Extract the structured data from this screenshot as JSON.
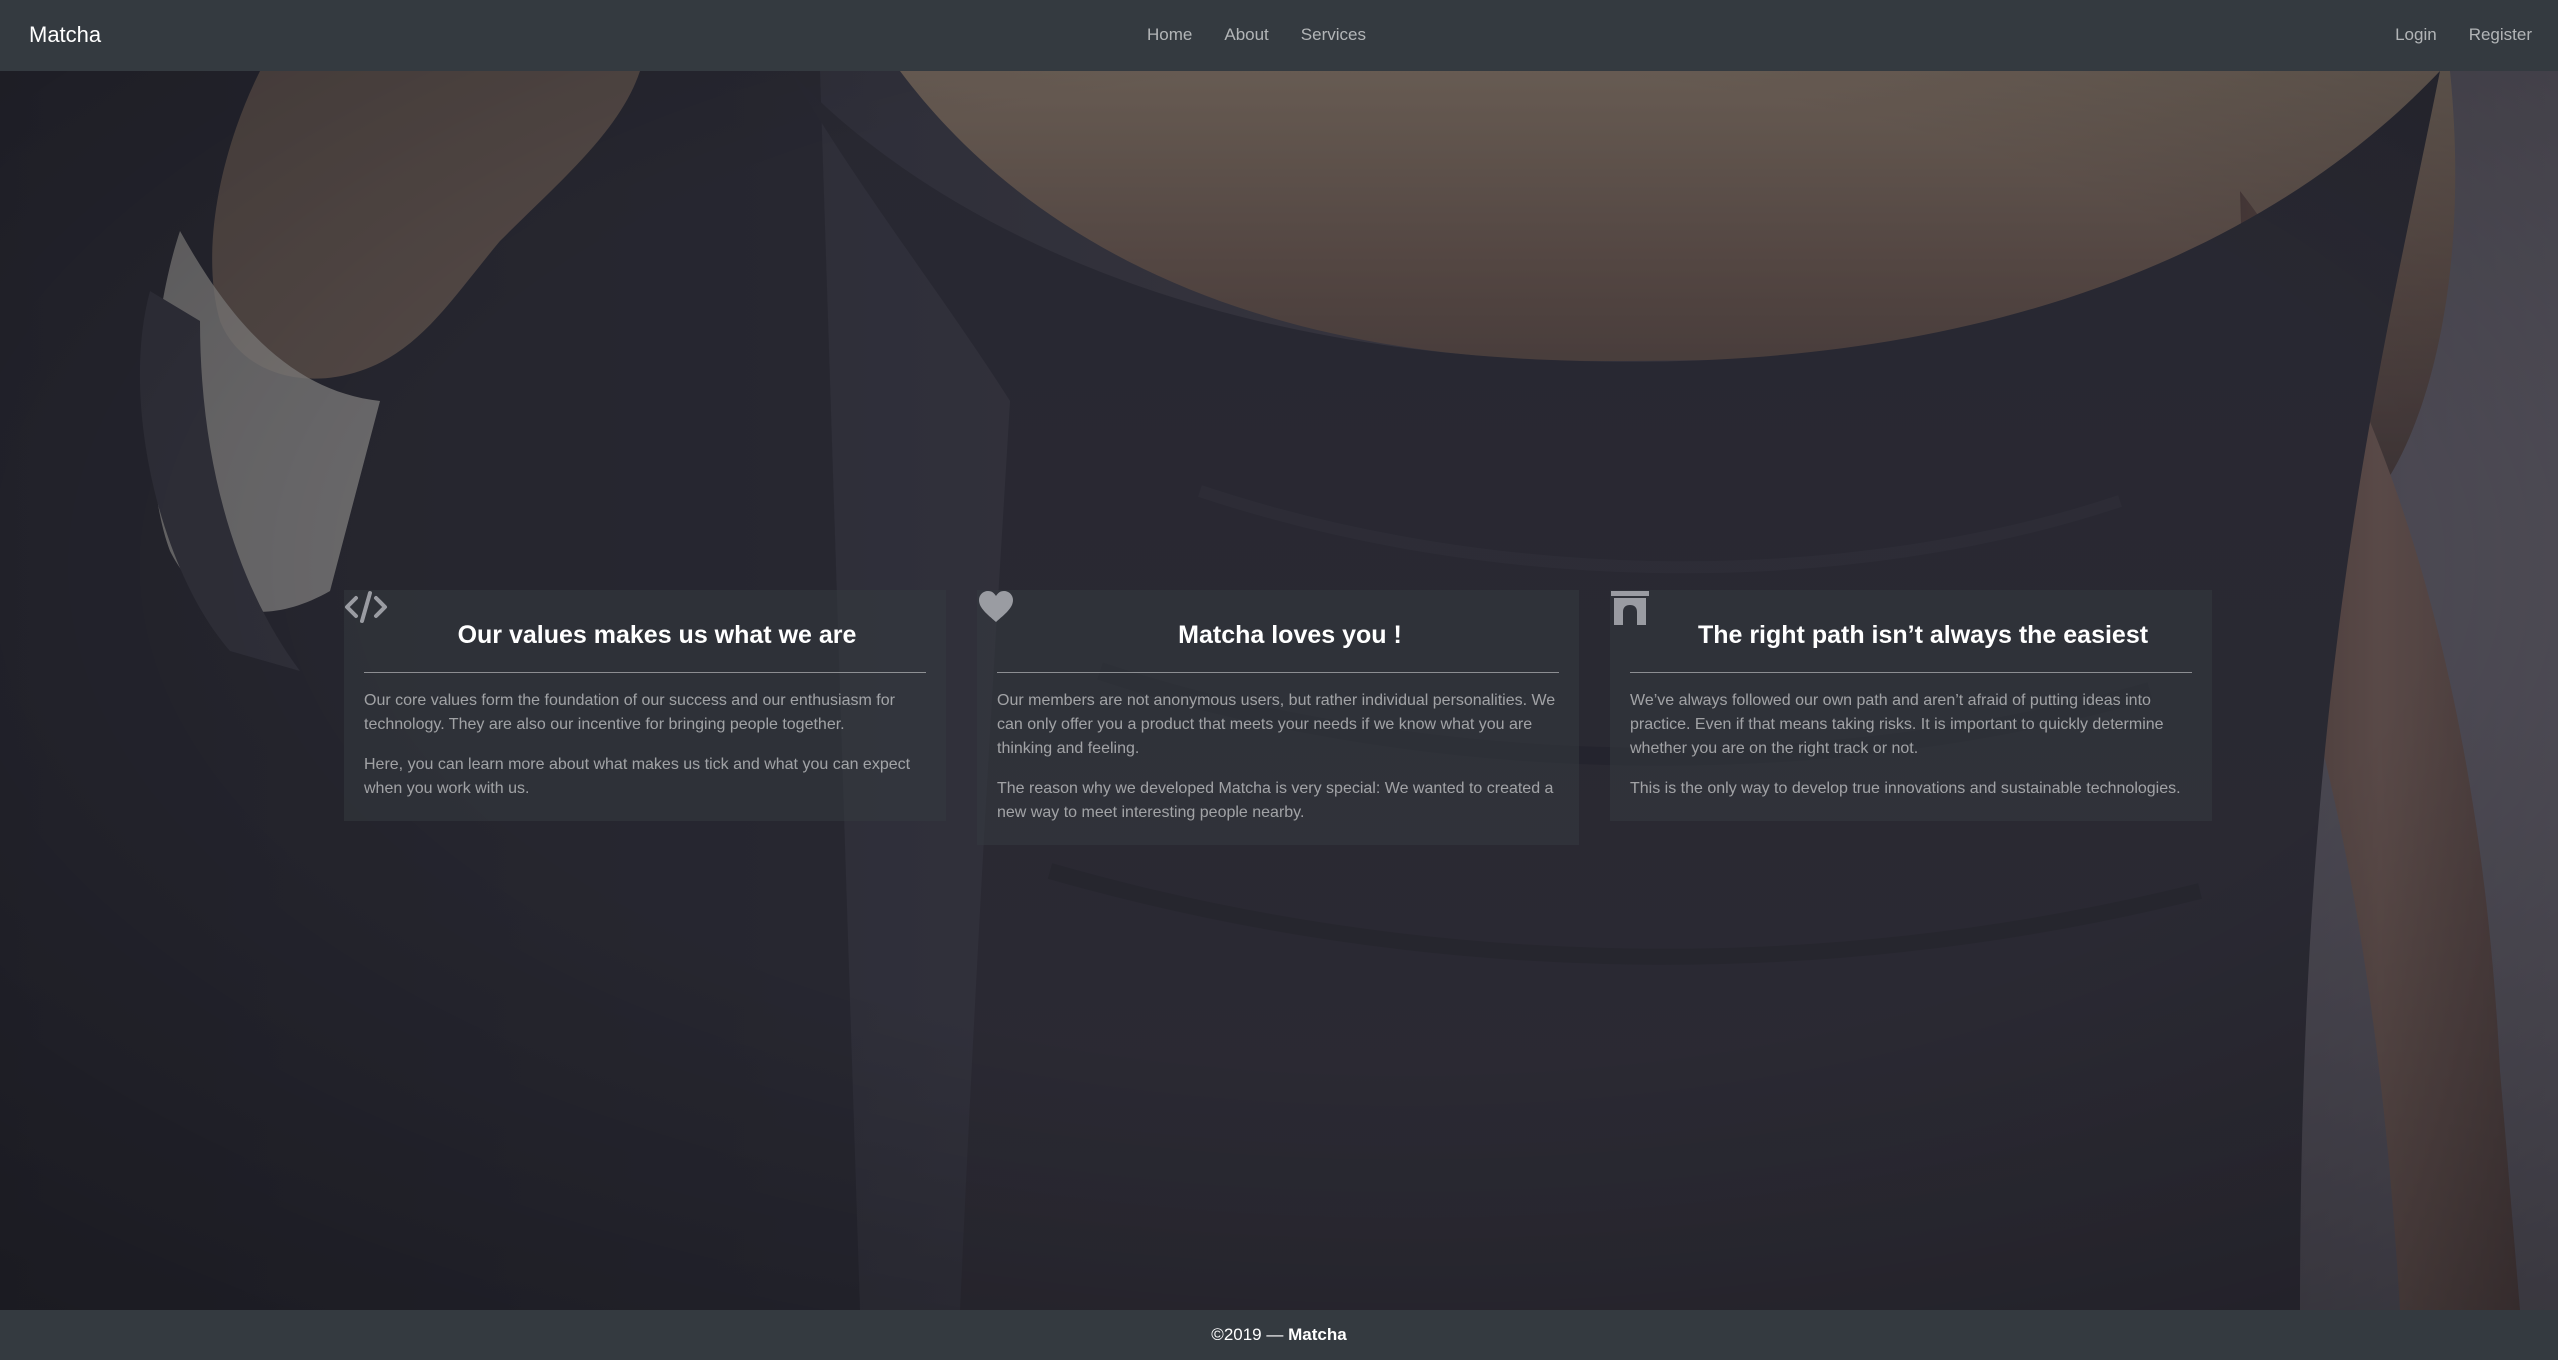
{
  "navbar": {
    "brand": "Matcha",
    "center_links": [
      {
        "label": "Home"
      },
      {
        "label": "About"
      },
      {
        "label": "Services"
      }
    ],
    "right_links": [
      {
        "label": "Login"
      },
      {
        "label": "Register"
      }
    ]
  },
  "cards": [
    {
      "icon": "code-icon",
      "title": "Our values makes us what we are",
      "paragraphs": [
        "Our core values form the foundation of our success and our enthusiasm for technology. They are also our incentive for bringing people together.",
        "Here, you can learn more about what makes us tick and what you can expect when you work with us."
      ]
    },
    {
      "icon": "heart-icon",
      "title": "Matcha loves you !",
      "paragraphs": [
        "Our members are not anonymous users, but rather individual personalities. We can only offer you a product that meets your needs if we know what you are thinking and feeling.",
        "The reason why we developed Matcha is very special: We wanted to created a new way to meet interesting people nearby."
      ]
    },
    {
      "icon": "archway-icon",
      "title": "The right path isn’t always the easiest",
      "paragraphs": [
        "We’ve always followed our own path and aren’t afraid of putting ideas into practice. Even if that means taking risks. It is important to quickly determine whether you are on the right track or not.",
        "This is the only way to develop true innovations and sustainable technologies."
      ]
    }
  ],
  "footer": {
    "copyright": "©2019 —",
    "brand": "Matcha"
  },
  "colors": {
    "navbar_bg": "#343a40",
    "card_bg": "rgba(52,58,64,0.55)",
    "text_muted": "rgba(255,255,255,0.55)"
  }
}
